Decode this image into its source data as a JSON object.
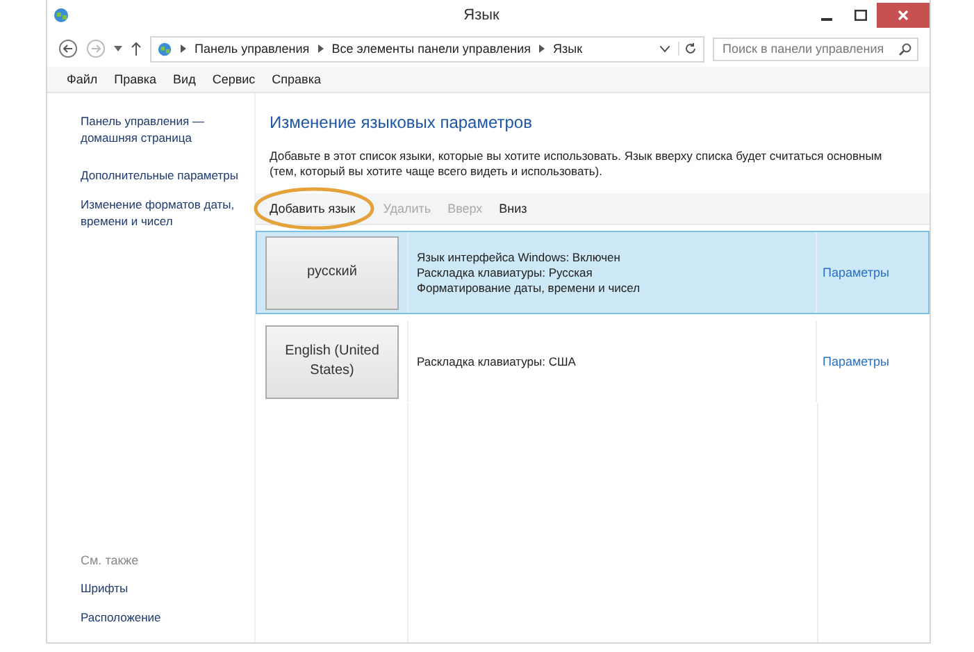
{
  "window": {
    "title": "Язык"
  },
  "address": {
    "path": [
      "Панель управления",
      "Все элементы панели управления",
      "Язык"
    ]
  },
  "search": {
    "placeholder": "Поиск в панели управления"
  },
  "menu": [
    "Файл",
    "Правка",
    "Вид",
    "Сервис",
    "Справка"
  ],
  "sidebar": {
    "links": [
      "Панель управления — домашняя страница",
      "Дополнительные параметры",
      "Изменение форматов даты, времени и чисел"
    ],
    "see_also": {
      "title": "См. также",
      "links": [
        "Шрифты",
        "Расположение"
      ]
    }
  },
  "heading": "Изменение языковых параметров",
  "description": "Добавьте в этот список языки, которые вы хотите использовать. Язык вверху списка будет считаться основным (тем, который вы хотите чаще всего видеть и использовать).",
  "toolbar": [
    {
      "label": "Добавить язык",
      "disabled": false
    },
    {
      "label": "Удалить",
      "disabled": true
    },
    {
      "label": "Вверх",
      "disabled": true
    },
    {
      "label": "Вниз",
      "disabled": false
    }
  ],
  "languages": [
    {
      "name": "русский",
      "selected": true,
      "details": [
        "Язык интерфейса Windows: Включен",
        "Раскладка клавиатуры: Русская",
        "Форматирование даты, времени и чисел"
      ],
      "options": "Параметры"
    },
    {
      "name": "English (United States)",
      "selected": false,
      "details": [
        "Раскладка клавиатуры: США"
      ],
      "options": "Параметры"
    }
  ]
}
